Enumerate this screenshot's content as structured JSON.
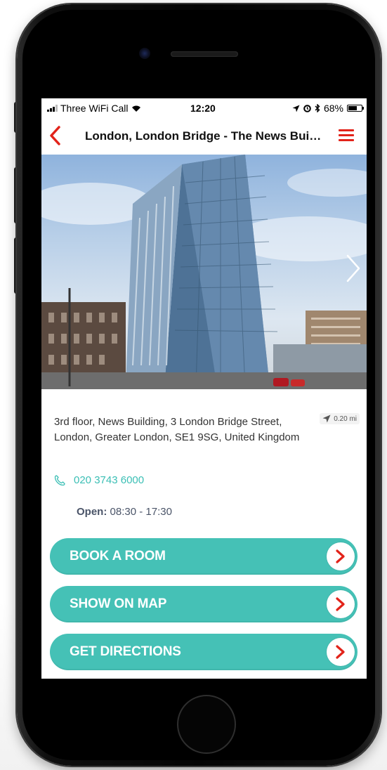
{
  "status_bar": {
    "carrier": "Three WiFi Call",
    "time": "12:20",
    "battery": "68%",
    "battery_level": 0.68
  },
  "header": {
    "title": "London, London Bridge - The News Building"
  },
  "location": {
    "address": "3rd floor, News Building, 3 London Bridge Street, London, Greater London, SE1 9SG, United Kingdom",
    "distance": "0.20 mi",
    "phone": "020 3743 6000",
    "hours_label": "Open:",
    "hours_value": "08:30 - 17:30"
  },
  "actions": [
    {
      "label": "BOOK A ROOM"
    },
    {
      "label": "SHOW ON MAP"
    },
    {
      "label": "GET DIRECTIONS"
    }
  ],
  "colors": {
    "accent_red": "#e2231a",
    "teal": "#45c1b6",
    "hours_text": "#4a5468"
  },
  "icons": {
    "back": "chevron-left-icon",
    "menu": "hamburger-menu-icon",
    "next": "chevron-right-icon",
    "distance": "location-arrow-icon",
    "phone": "phone-icon",
    "action": "chevron-right-circle-icon"
  }
}
